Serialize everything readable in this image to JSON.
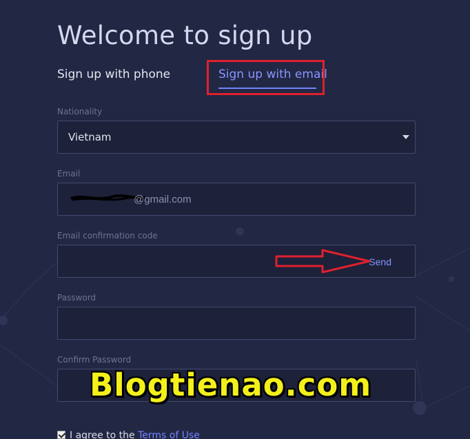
{
  "page": {
    "title": "Welcome to sign up"
  },
  "tabs": {
    "phone_label": "Sign up with phone",
    "email_label": "Sign up with email",
    "active": "email"
  },
  "form": {
    "nationality": {
      "label": "Nationality",
      "value": "Vietnam"
    },
    "email": {
      "label": "Email",
      "value_visible_suffix": "@gmail.com"
    },
    "code": {
      "label": "Email confirmation code",
      "send_label": "Send"
    },
    "password": {
      "label": "Password"
    },
    "confirm_password": {
      "label": "Confirm Password"
    },
    "agree": {
      "text": "I agree to the ",
      "link": "Terms of Use",
      "checked": true
    }
  },
  "watermark": "Blogtienao.com",
  "colors": {
    "background": "#222744",
    "accent": "#7384ff",
    "highlight": "#e0202e",
    "watermark": "#f3f01b"
  }
}
